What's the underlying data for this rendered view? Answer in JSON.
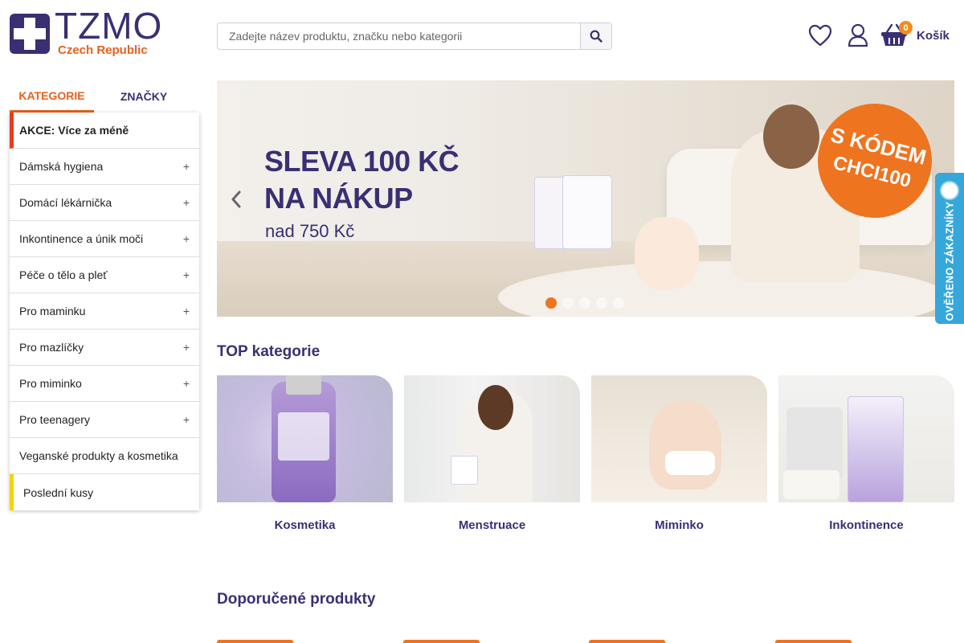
{
  "header": {
    "logo_title": "TZMO",
    "logo_subtitle": "Czech Republic",
    "search_placeholder": "Zadejte název produktu, značku nebo kategorii",
    "cart_count": "0",
    "cart_label": "Košík"
  },
  "sidebar": {
    "tabs": [
      "KATEGORIE",
      "ZNAČKY"
    ],
    "items": [
      {
        "label": "AKCE: Více za méně"
      },
      {
        "label": "Dámská hygiena"
      },
      {
        "label": "Domácí lékárnička"
      },
      {
        "label": "Inkontinence a únik moči"
      },
      {
        "label": "Péče o tělo a pleť"
      },
      {
        "label": "Pro maminku"
      },
      {
        "label": "Pro mazlíčky"
      },
      {
        "label": "Pro miminko"
      },
      {
        "label": "Pro teenagery"
      },
      {
        "label": "Veganské produkty a kosmetika"
      },
      {
        "label": "Poslední kusy"
      }
    ],
    "expand_symbol": "+"
  },
  "banner": {
    "line1": "SLEVA 100 KČ",
    "line2": "NA NÁKUP",
    "line3": "nad 750 Kč",
    "badge_line1": "S KÓDEM",
    "badge_line2": "CHCI100",
    "slide_count": 5,
    "active_slide": 1
  },
  "verified_widget": {
    "label": "OVĚŘENO ZÁKAZNÍKY"
  },
  "top_categories": {
    "title": "TOP kategorie",
    "items": [
      {
        "label": "Kosmetika"
      },
      {
        "label": "Menstruace"
      },
      {
        "label": "Miminko"
      },
      {
        "label": "Inkontinence"
      }
    ]
  },
  "recommended": {
    "title": "Doporučené produkty"
  },
  "colors": {
    "brand": "#3a2f73",
    "accent": "#e8601c",
    "badge": "#ee7420",
    "verified": "#35a7db"
  }
}
